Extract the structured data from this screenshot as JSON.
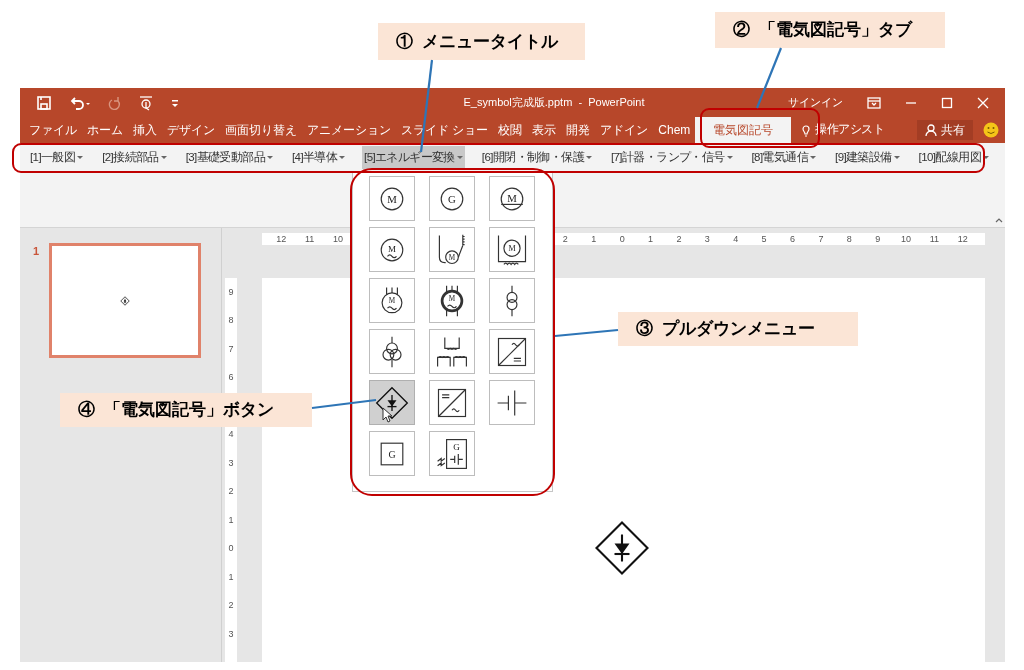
{
  "window": {
    "title": "E_symbol完成版.pptm  -  PowerPoint",
    "signin": "サインイン"
  },
  "quick_access": [
    {
      "kind": "save",
      "disabled": false
    },
    {
      "kind": "undo",
      "disabled": false
    },
    {
      "kind": "redo",
      "disabled": true
    },
    {
      "kind": "touch",
      "disabled": false
    },
    {
      "kind": "customize",
      "disabled": false
    }
  ],
  "tabs": [
    {
      "label": "ファイル",
      "selected": false
    },
    {
      "label": "ホーム",
      "selected": false
    },
    {
      "label": "挿入",
      "selected": false
    },
    {
      "label": "デザイン",
      "selected": false
    },
    {
      "label": "画面切り替え",
      "selected": false
    },
    {
      "label": "アニメーション",
      "selected": false
    },
    {
      "label": "スライド ショー",
      "selected": false
    },
    {
      "label": "校閲",
      "selected": false
    },
    {
      "label": "表示",
      "selected": false
    },
    {
      "label": "開発",
      "selected": false
    },
    {
      "label": "アドイン",
      "selected": false
    },
    {
      "label": "Chem",
      "selected": false
    },
    {
      "label": "電気図記号",
      "selected": true
    }
  ],
  "tell_me": "操作アシスト",
  "share": "共有",
  "menu_titles": [
    {
      "label": "[1]一般図",
      "selected": false
    },
    {
      "label": "[2]接続部品",
      "selected": false
    },
    {
      "label": "[3]基礎受動部品",
      "selected": false
    },
    {
      "label": "[4]半導体",
      "selected": false
    },
    {
      "label": "[5]エネルギー変換",
      "selected": true
    },
    {
      "label": "[6]開閉・制御・保護",
      "selected": false
    },
    {
      "label": "[7]計器・ランプ・信号",
      "selected": false
    },
    {
      "label": "[8]電気通信",
      "selected": false
    },
    {
      "label": "[9]建築設備",
      "selected": false
    },
    {
      "label": "[10]配線用図",
      "selected": false
    }
  ],
  "dropdown": {
    "symbols": [
      {
        "kind": "circle",
        "letter": "M",
        "selected": false
      },
      {
        "kind": "circle",
        "letter": "G",
        "selected": false
      },
      {
        "kind": "circle-underline",
        "letter": "M",
        "selected": false
      },
      {
        "kind": "circle-tilde",
        "letter": "M",
        "selected": false
      },
      {
        "kind": "motor-coil",
        "letter": "M",
        "selected": false
      },
      {
        "kind": "motor-frame",
        "letter": "M",
        "selected": false
      },
      {
        "kind": "motor-terminals",
        "letter": "M",
        "selected": false
      },
      {
        "kind": "motor-terminals-bold",
        "letter": "M",
        "selected": false
      },
      {
        "kind": "transformer",
        "selected": false
      },
      {
        "kind": "transformer-3",
        "selected": false
      },
      {
        "kind": "coils",
        "selected": false
      },
      {
        "kind": "converter",
        "selected": false
      },
      {
        "kind": "rectifier-diamond",
        "selected": true
      },
      {
        "kind": "converter-reverse",
        "selected": false
      },
      {
        "kind": "battery",
        "selected": false
      },
      {
        "kind": "box-letter",
        "letter": "G",
        "selected": false
      },
      {
        "kind": "box-battery",
        "letter": "G",
        "selected": false
      }
    ]
  },
  "slides": [
    {
      "number": "1",
      "selected": true
    }
  ],
  "horizontal_ruler": {
    "left_labels": [
      "12",
      "11",
      "10"
    ],
    "right_labels": [
      "2",
      "1",
      "0",
      "1",
      "2",
      "3",
      "4",
      "5",
      "6",
      "7",
      "8",
      "9",
      "10",
      "11",
      "12"
    ]
  },
  "vertical_ruler": {
    "top_labels": [
      "9",
      "8",
      "7",
      "6"
    ],
    "bottom_labels": [
      "4",
      "3",
      "2",
      "1",
      "0",
      "1",
      "2",
      "3"
    ]
  },
  "annotations": [
    {
      "text": "①  メニュータイトル"
    },
    {
      "text": "②  「電気図記号」タブ"
    },
    {
      "text": "③  プルダウンメニュー"
    },
    {
      "text": "④  「電気図記号」ボタン"
    }
  ]
}
